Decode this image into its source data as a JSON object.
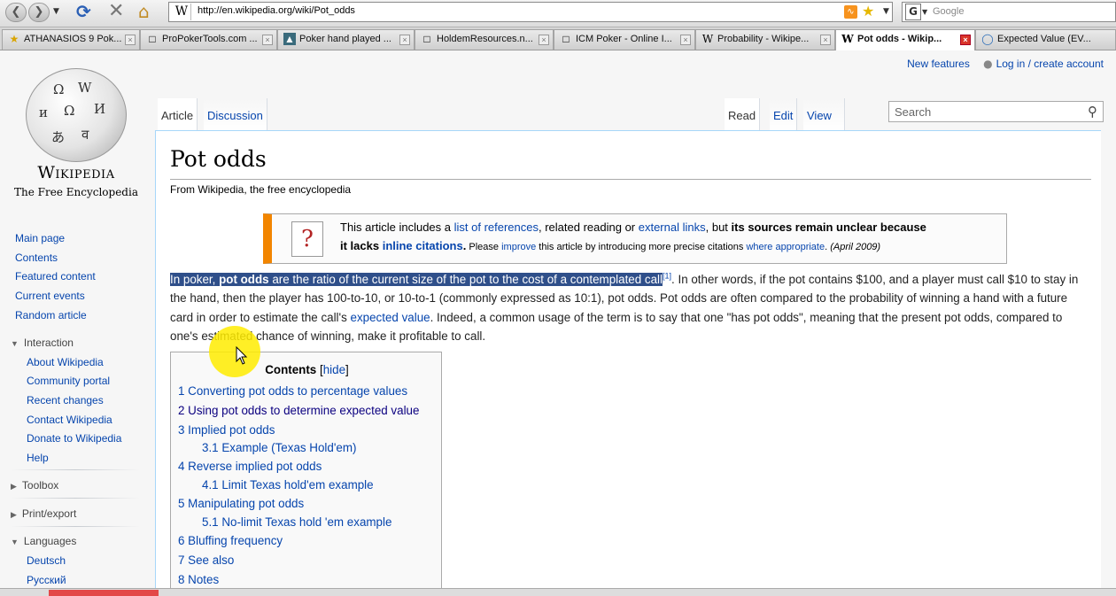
{
  "browser": {
    "url": "http://en.wikipedia.org/wiki/Pot_odds",
    "search_placeholder": "Google",
    "icons": {
      "back": "back-arrow-icon",
      "forward": "forward-arrow-icon",
      "reload": "reload-icon",
      "stop": "stop-icon",
      "home": "home-icon",
      "rss": "rss-icon",
      "bookmark": "star-icon"
    },
    "tabs": [
      {
        "title": "ATHANASIOS 9 Pok...",
        "icon": "star"
      },
      {
        "title": "ProPokerTools.com ...",
        "icon": "page"
      },
      {
        "title": "Poker hand played ...",
        "icon": "image"
      },
      {
        "title": "HoldemResources.n...",
        "icon": "page"
      },
      {
        "title": "ICM Poker - Online I...",
        "icon": "page"
      },
      {
        "title": "Probability - Wikipe...",
        "icon": "W"
      },
      {
        "title": "Pot odds - Wikip...",
        "icon": "W",
        "active": true
      },
      {
        "title": "Expected Value (EV...",
        "icon": "globe"
      }
    ]
  },
  "wiki": {
    "personal": {
      "new_features": "New features",
      "login": "Log in / create account"
    },
    "logo": {
      "wordmark": "Wikipedia",
      "tagline": "The Free Encyclopedia"
    },
    "nav": [
      "Main page",
      "Contents",
      "Featured content",
      "Current events",
      "Random article"
    ],
    "interaction": {
      "title": "Interaction",
      "items": [
        "About Wikipedia",
        "Community portal",
        "Recent changes",
        "Contact Wikipedia",
        "Donate to Wikipedia",
        "Help"
      ]
    },
    "toolbox": "Toolbox",
    "print_export": "Print/export",
    "languages": {
      "title": "Languages",
      "items": [
        "Deutsch",
        "Русский"
      ]
    },
    "tabs_left": [
      "Article",
      "Discussion"
    ],
    "tabs_right": [
      "Read",
      "Edit",
      "View history"
    ],
    "search_placeholder": "Search",
    "title": "Pot odds",
    "site_sub": "From Wikipedia, the free encyclopedia",
    "ambox": {
      "t1a": "This article includes a ",
      "t1b": "list of references",
      "t1c": ", related reading or ",
      "t1d": "external links",
      "t1e": ", but ",
      "t1f": "its sources remain unclear because",
      "t2a": "it lacks ",
      "t2b": "inline citations",
      "t2c": ".",
      "t2d": " Please ",
      "t2e": "improve",
      "t2f": " this article by introducing more precise citations ",
      "t2g": "where appropriate",
      "t2h": ".",
      "t2i": " (April 2009)"
    },
    "para": {
      "p1": "In poker, ",
      "p2": "pot odds",
      "p3": " are the ratio of the current size of the pot to the cost of a contemplated call",
      "ref": "[1]",
      "p4": ". In other words, if the pot contains $100, and a player must call $10 to stay in the hand, then the player has 100-to-10, or 10-to-1 (commonly expressed as 10:1), pot odds. Pot odds are often compared to the probability of winning a hand with a future card in order to estimate the call's ",
      "p5": "expected value",
      "p6": ". Indeed, a common usage of the term is to say that one \"has pot odds\", meaning that the present pot odds, compared to one's estimated chance of winning, make it profitable to call."
    },
    "toc": {
      "title": "Contents",
      "hide": "hide",
      "items": [
        "1 Converting pot odds to percentage values",
        "2 Using pot odds to determine expected value",
        "3 Implied pot odds",
        "3.1 Example (Texas Hold'em)",
        "4 Reverse implied pot odds",
        "4.1 Limit Texas hold'em example",
        "5 Manipulating pot odds",
        "5.1 No-limit Texas hold 'em example",
        "6 Bluffing frequency",
        "7 See also",
        "8 Notes"
      ]
    }
  }
}
